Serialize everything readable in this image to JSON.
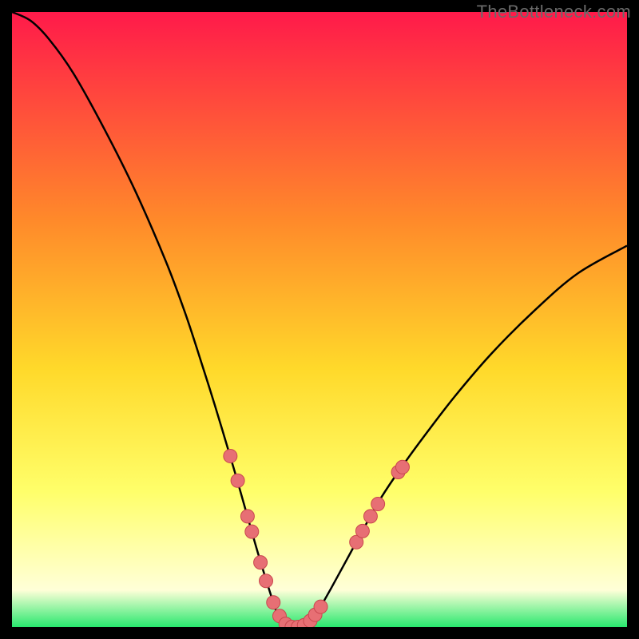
{
  "watermark": "TheBottleneck.com",
  "colors": {
    "gradient_top": "#ff1a4a",
    "gradient_mid1": "#ff8a2a",
    "gradient_mid2": "#ffd92a",
    "gradient_mid3": "#ffff6a",
    "gradient_pale": "#ffffd8",
    "gradient_bottom": "#28e86e",
    "curve": "#000000",
    "marker_fill": "#e76f74",
    "marker_stroke": "#c9474e",
    "frame": "#000000"
  },
  "chart_data": {
    "type": "line",
    "title": "",
    "xlabel": "",
    "ylabel": "",
    "xlim": [
      0,
      100
    ],
    "ylim": [
      0,
      100
    ],
    "grid": false,
    "legend": false,
    "curve": {
      "description": "V-shaped bottleneck curve; y ≈ 100 at x=0, drops to 0 near x≈46, flat 0 on 43–49, rises to ≈62 at x=100; right arm shallower than left.",
      "points": [
        {
          "x": 0.0,
          "y": 100.0
        },
        {
          "x": 3.0,
          "y": 98.6
        },
        {
          "x": 6.0,
          "y": 95.6
        },
        {
          "x": 10.0,
          "y": 90.0
        },
        {
          "x": 15.0,
          "y": 81.0
        },
        {
          "x": 20.0,
          "y": 71.0
        },
        {
          "x": 25.0,
          "y": 59.5
        },
        {
          "x": 28.0,
          "y": 51.5
        },
        {
          "x": 30.0,
          "y": 45.5
        },
        {
          "x": 33.0,
          "y": 36.0
        },
        {
          "x": 36.0,
          "y": 26.0
        },
        {
          "x": 38.0,
          "y": 19.0
        },
        {
          "x": 40.0,
          "y": 12.0
        },
        {
          "x": 42.0,
          "y": 5.5
        },
        {
          "x": 43.0,
          "y": 2.5
        },
        {
          "x": 44.0,
          "y": 0.8
        },
        {
          "x": 45.0,
          "y": 0.0
        },
        {
          "x": 46.0,
          "y": 0.0
        },
        {
          "x": 47.0,
          "y": 0.0
        },
        {
          "x": 48.0,
          "y": 0.5
        },
        {
          "x": 49.0,
          "y": 1.5
        },
        {
          "x": 50.0,
          "y": 3.0
        },
        {
          "x": 52.0,
          "y": 6.5
        },
        {
          "x": 55.0,
          "y": 12.0
        },
        {
          "x": 58.0,
          "y": 17.5
        },
        {
          "x": 60.0,
          "y": 21.0
        },
        {
          "x": 63.0,
          "y": 25.5
        },
        {
          "x": 67.0,
          "y": 31.0
        },
        {
          "x": 72.0,
          "y": 37.5
        },
        {
          "x": 78.0,
          "y": 44.5
        },
        {
          "x": 85.0,
          "y": 51.5
        },
        {
          "x": 92.0,
          "y": 57.5
        },
        {
          "x": 100.0,
          "y": 62.0
        }
      ]
    },
    "markers": [
      {
        "x": 35.5,
        "y": 27.8
      },
      {
        "x": 36.7,
        "y": 23.8
      },
      {
        "x": 38.3,
        "y": 18.0
      },
      {
        "x": 39.0,
        "y": 15.5
      },
      {
        "x": 40.4,
        "y": 10.5
      },
      {
        "x": 41.3,
        "y": 7.5
      },
      {
        "x": 42.5,
        "y": 4.0
      },
      {
        "x": 43.5,
        "y": 1.8
      },
      {
        "x": 44.5,
        "y": 0.5
      },
      {
        "x": 45.5,
        "y": 0.0
      },
      {
        "x": 46.5,
        "y": 0.0
      },
      {
        "x": 47.5,
        "y": 0.3
      },
      {
        "x": 48.5,
        "y": 1.0
      },
      {
        "x": 49.3,
        "y": 2.0
      },
      {
        "x": 50.2,
        "y": 3.3
      },
      {
        "x": 56.0,
        "y": 13.8
      },
      {
        "x": 57.0,
        "y": 15.6
      },
      {
        "x": 58.3,
        "y": 18.0
      },
      {
        "x": 59.5,
        "y": 20.0
      },
      {
        "x": 62.8,
        "y": 25.2
      },
      {
        "x": 63.5,
        "y": 26.0
      }
    ]
  }
}
